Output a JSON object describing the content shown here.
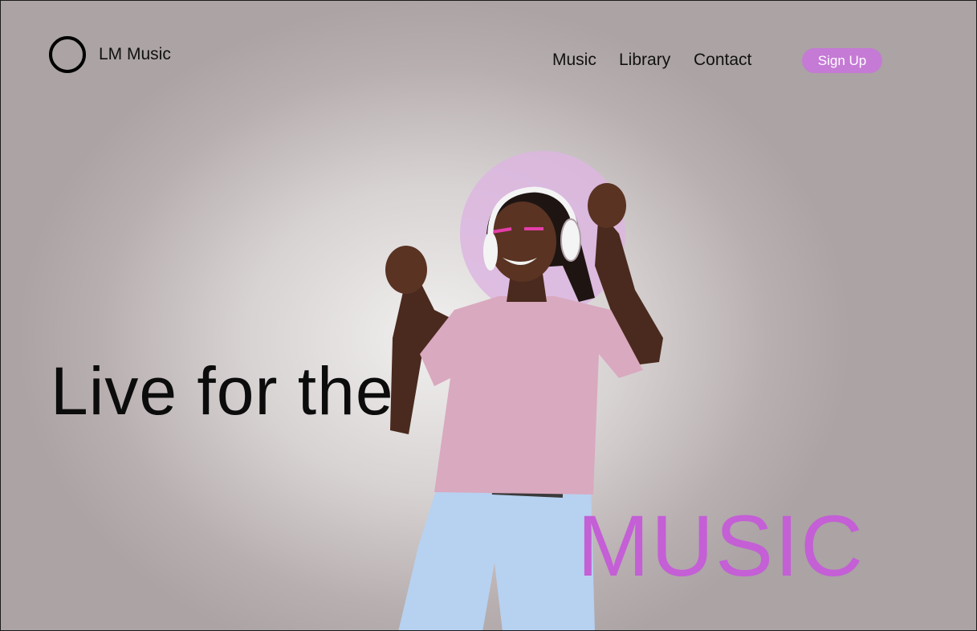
{
  "brand": {
    "name": "LM Music"
  },
  "nav": {
    "items": [
      "Music",
      "Library",
      "Contact"
    ]
  },
  "cta": {
    "signup_label": "Sign Up"
  },
  "hero": {
    "headline": "Live for the",
    "accent_word": "MUSIC"
  },
  "colors": {
    "accent": "#c45fd6",
    "button": "#c57ad5",
    "halo": "#dcb6e0"
  }
}
